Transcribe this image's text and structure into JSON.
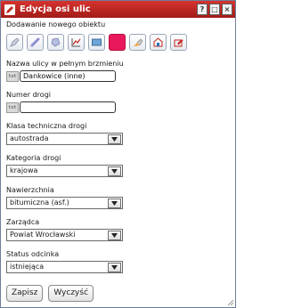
{
  "window": {
    "title": "Edycja osi ulic",
    "buttons": [
      "?",
      "□",
      "×"
    ],
    "accent": "#c0271f"
  },
  "subtitle": "Dodawanie nowego obiektu",
  "toolbar": {
    "tools": [
      {
        "icon": "point-icon"
      },
      {
        "icon": "line-icon"
      },
      {
        "icon": "polygon-icon"
      },
      {
        "icon": "axis-chart-icon"
      },
      {
        "icon": "rectangle-icon"
      },
      {
        "icon": "color-swatch-icon",
        "active": true,
        "color": "#e8185a"
      },
      {
        "icon": "paint-icon"
      },
      {
        "icon": "home-edit-icon"
      },
      {
        "icon": "edit-icon"
      }
    ]
  },
  "form": {
    "txt_tag": "txt",
    "street_name": {
      "label": "Nazwa ulicy w pełnym brzmieniu",
      "value": "Dankowice (inne)"
    },
    "road_number": {
      "label": "Numer drogi",
      "value": ""
    },
    "technical_class": {
      "label": "Klasa techniczna drogi",
      "value": "autostrada"
    },
    "category": {
      "label": "Kategoria drogi",
      "value": "krajowa"
    },
    "surface": {
      "label": "Nawierzchnia",
      "value": "bitumiczna (asf.)"
    },
    "manager": {
      "label": "Zarządca",
      "value": "Powiat Wrocławski"
    },
    "status": {
      "label": "Status odcinka",
      "value": "istniejąca"
    }
  },
  "actions": {
    "save": "Zapisz",
    "clear": "Wyczyść"
  }
}
